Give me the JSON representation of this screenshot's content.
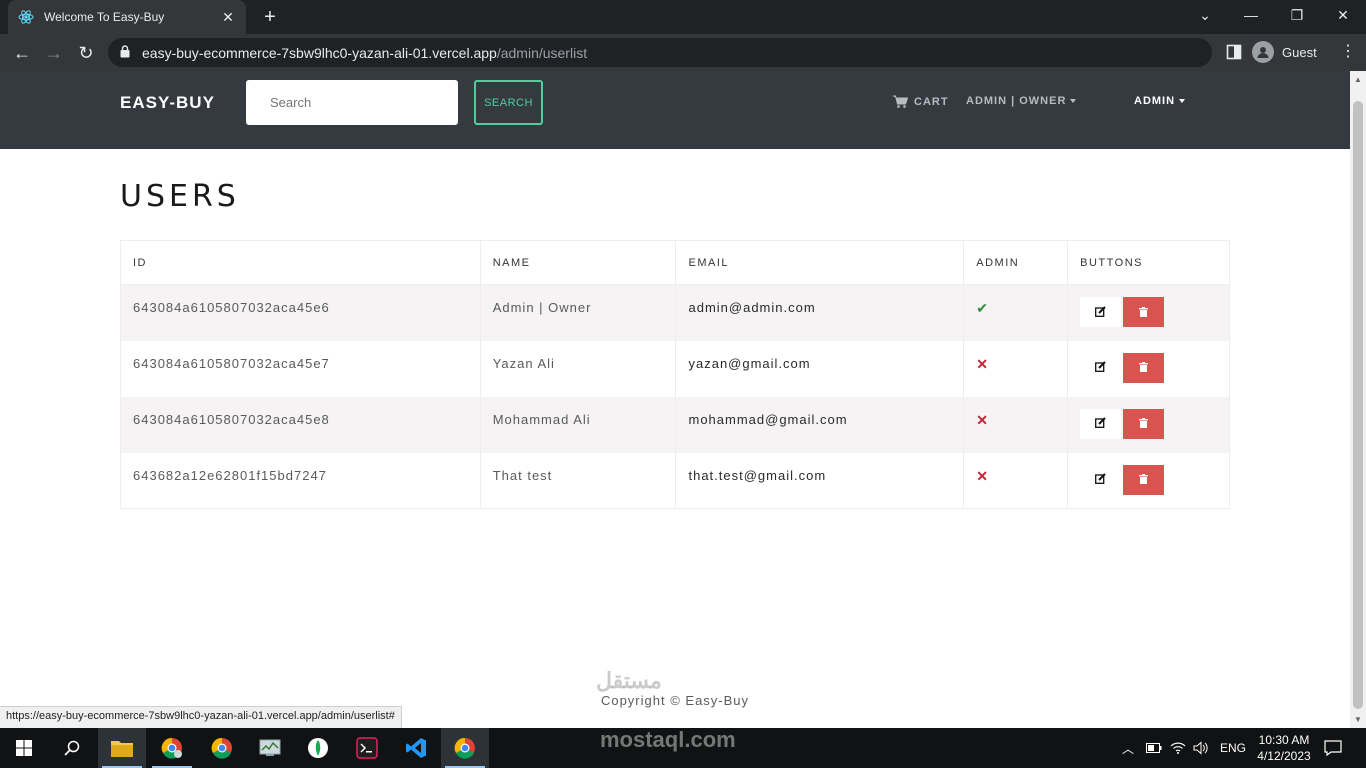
{
  "browser": {
    "tab_title": "Welcome To Easy-Buy",
    "url_host": "easy-buy-ecommerce-7sbw9lhc0-yazan-ali-01.vercel.app",
    "url_path": "/admin/userlist",
    "profile_label": "Guest",
    "status_url": "https://easy-buy-ecommerce-7sbw9lhc0-yazan-ali-01.vercel.app/admin/userlist#"
  },
  "navbar": {
    "brand": "EASY-BUY",
    "search_placeholder": "Search",
    "search_button": "SEARCH",
    "cart_label": "CART",
    "user_menu": "ADMIN | OWNER",
    "admin_menu": "ADMIN"
  },
  "main": {
    "title": "USERS",
    "columns": [
      "ID",
      "NAME",
      "EMAIL",
      "ADMIN",
      "BUTTONS"
    ],
    "users": [
      {
        "id": "643084a6105807032aca45e6",
        "name": "Admin | Owner",
        "email": "admin@admin.com",
        "is_admin": true
      },
      {
        "id": "643084a6105807032aca45e7",
        "name": "Yazan Ali",
        "email": "yazan@gmail.com",
        "is_admin": false
      },
      {
        "id": "643084a6105807032aca45e8",
        "name": "Mohammad Ali",
        "email": "mohammad@gmail.com",
        "is_admin": false
      },
      {
        "id": "643682a12e62801f15bd7247",
        "name": "That test",
        "email": "that.test@gmail.com",
        "is_admin": false
      }
    ]
  },
  "footer": {
    "copyright": "Copyright © Easy-Buy"
  },
  "watermark": {
    "arabic": "مستقل",
    "latin": "mostaql.com"
  },
  "taskbar": {
    "language": "ENG",
    "time": "10:30 AM",
    "date": "4/12/2023"
  },
  "colors": {
    "navbar_bg": "#343a40",
    "accent_green": "#56cc9d",
    "danger": "#d9534f",
    "check": "#2f8a3a",
    "cross": "#c82333"
  }
}
